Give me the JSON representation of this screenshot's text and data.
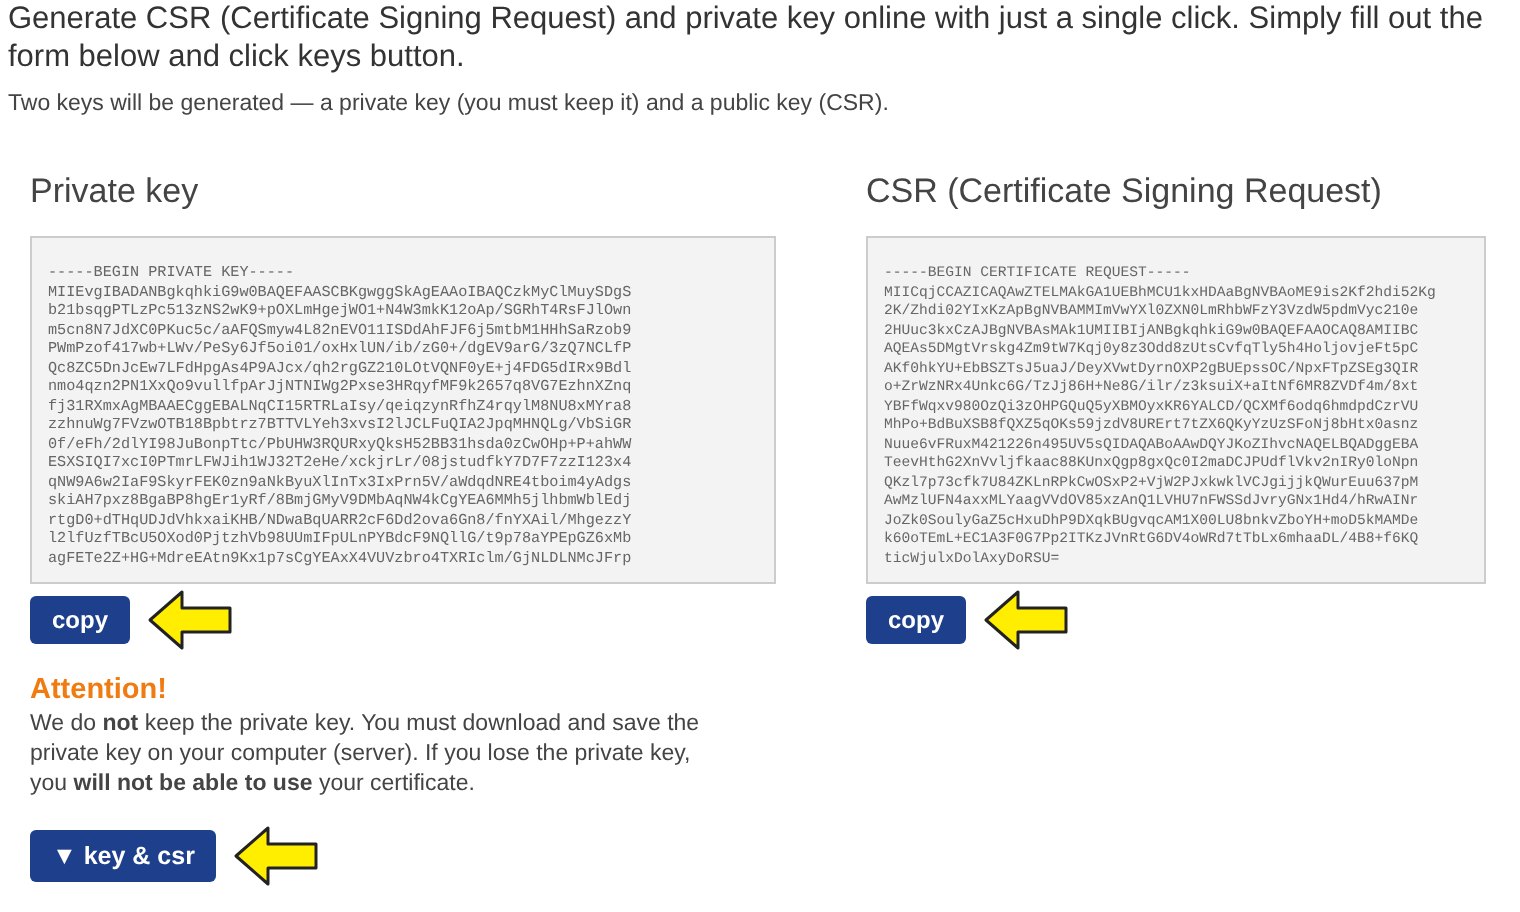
{
  "intro": "Generate CSR (Certificate Signing Request) and private key online with just a single click. Simply fill out the form below and click keys button.",
  "note": "Two keys will be generated — a private key (you must keep it) and a public key (CSR).",
  "panels": [
    {
      "title": "Private key",
      "lines": [
        "-----BEGIN PRIVATE KEY-----",
        "MIIEvgIBADANBgkqhkiG9w0BAQEFAASCBKgwggSkAgEAAoIBAQCzkMyClMuySDgS",
        "b21bsqgPTLzPc513zNS2wK9+pOXLmHgejWO1+N4W3mkK12oAp/SGRhT4RsFJlOwn",
        "m5cn8N7JdXC0PKuc5c/aAFQSmyw4L82nEVO11ISDdAhFJF6j5mtbM1HHhSaRzob9",
        "PWmPzof417wb+LWv/PeSy6Jf5oi01/oxHxlUN/ib/zG0+/dgEV9arG/3zQ7NCLfP",
        "Qc8ZC5DnJcEw7LFdHpgAs4P9AJcx/qh2rgGZ210LOtVQNF0yE+j4FDG5dIRx9Bdl",
        "nmo4qzn2PN1XxQo9vullfpArJjNTNIWg2Pxse3HRqyfMF9k2657q8VG7EzhnXZnq",
        "fj31RXmxAgMBAAECggEBALNqCI15RTRLaIsy/qeiqzynRfhZ4rqylM8NU8xMYra8",
        "zzhnuWg7FVzwOTB18Bpbtrz7BTTVLYeh3xvsI2lJCLFuQIA2JpqMHNQLg/VbSiGR",
        "0f/eFh/2dlYI98JuBonpTtc/PbUHW3RQURxyQksH52BB31hsda0zCwOHp+P+ahWW",
        "ESXSIQI7xcI0PTmrLFWJih1WJ32T2eHe/xckjrLr/08jstudfkY7D7F7zzI123x4",
        "qNW9A6w2IaF9SkyrFEK0zn9aNkByuXlInTx3IxPrn5V/aWdqdNRE4tboim4yAdgs",
        "skiAH7pxz8BgaBP8hgEr1yRf/8BmjGMyV9DMbAqNW4kCgYEA6MMh5jlhbmWblEdj",
        "rtgD0+dTHqUDJdVhkxaiKHB/NDwaBqUARR2cF6Dd2ova6Gn8/fnYXAil/MhgezzY",
        "l2lfUzfTBcU5OXod0PjtzhVb98UUmIFpULnPYBdcF9NQllG/t9p78aYPEpGZ6xMb",
        "agFETe2Z+HG+MdreEAtn9Kx1p7sCgYEAxX4VUVzbro4TXRIclm/GjNLDLNMcJFrp"
      ],
      "button": "copy"
    },
    {
      "title": "CSR (Certificate Signing Request)",
      "lines": [
        "-----BEGIN CERTIFICATE REQUEST-----",
        "MIICqjCCAZICAQAwZTELMAkGA1UEBhMCU1kxHDAaBgNVBAoME9is2Kf2hdi52Kg",
        "2K/Zhdi02YIxKzApBgNVBAMMImVwYXl0ZXN0LmRhbWFzY3VzdW5pdmVyc210e",
        "2HUuc3kxCzAJBgNVBAsMAk1UMIIBIjANBgkqhkiG9w0BAQEFAAOCAQ8AMIIBC",
        "AQEAs5DMgtVrskg4Zm9tW7Kqj0y8z3Odd8zUtsCvfqTly5h4HoljovjeFt5pC",
        "AKf0hkYU+EbBSZTsJ5uaJ/DeyXVwtDyrnOXP2gBUEpssOC/NpxFTpZSEg3QIR",
        "o+ZrWzNRx4Unkc6G/TzJj86H+Ne8G/ilr/z3ksuiX+aItNf6MR8ZVDf4m/8xt",
        "YBFfWqxv980OzQi3zOHPGQuQ5yXBMOyxKR6YALCD/QCXMf6odq6hmdpdCzrVU",
        "MhPo+BdBuXSB8fQXZ5qOKs59jzdV8URErt7tZX6QKyYzUzSFoNj8bHtx0asnz",
        "Nuue6vFRuxM421226n495UV5sQIDAQABoAAwDQYJKoZIhvcNAQELBQADggEBA",
        "TeevHthG2XnVvljfkaac88KUnxQgp8gxQc0I2maDCJPUdflVkv2nIRy0loNpn",
        "QKzl7p73cfk7U84ZKLnRPkCwOSxP2+VjW2PJxkwklVCJgijjkQWurEuu637pM",
        "AwMzlUFN4axxMLYaagVVdOV85xzAnQ1LVHU7nFWSSdJvryGNx1Hd4/hRwAINr",
        "JoZk0SoulyGaZ5cHxuDhP9DXqkBUgvqcAM1X00LU8bnkvZboYH+moD5kMAMDe",
        "k60oTEmL+EC1A3F0G7Pp2ITKzJVnRtG6DV4oWRd7tTbLx6mhaaDL/4B8+f6KQ",
        "ticWjulxDolAxyDoRSU="
      ],
      "button": "copy"
    }
  ],
  "attention": {
    "title": "Attention!",
    "text": "We do **not** keep the private key. You must download and save the private key on your computer (server). If you lose the private key, you **will not be able to use** your certificate."
  },
  "toggle_button": "▼ key & csr"
}
